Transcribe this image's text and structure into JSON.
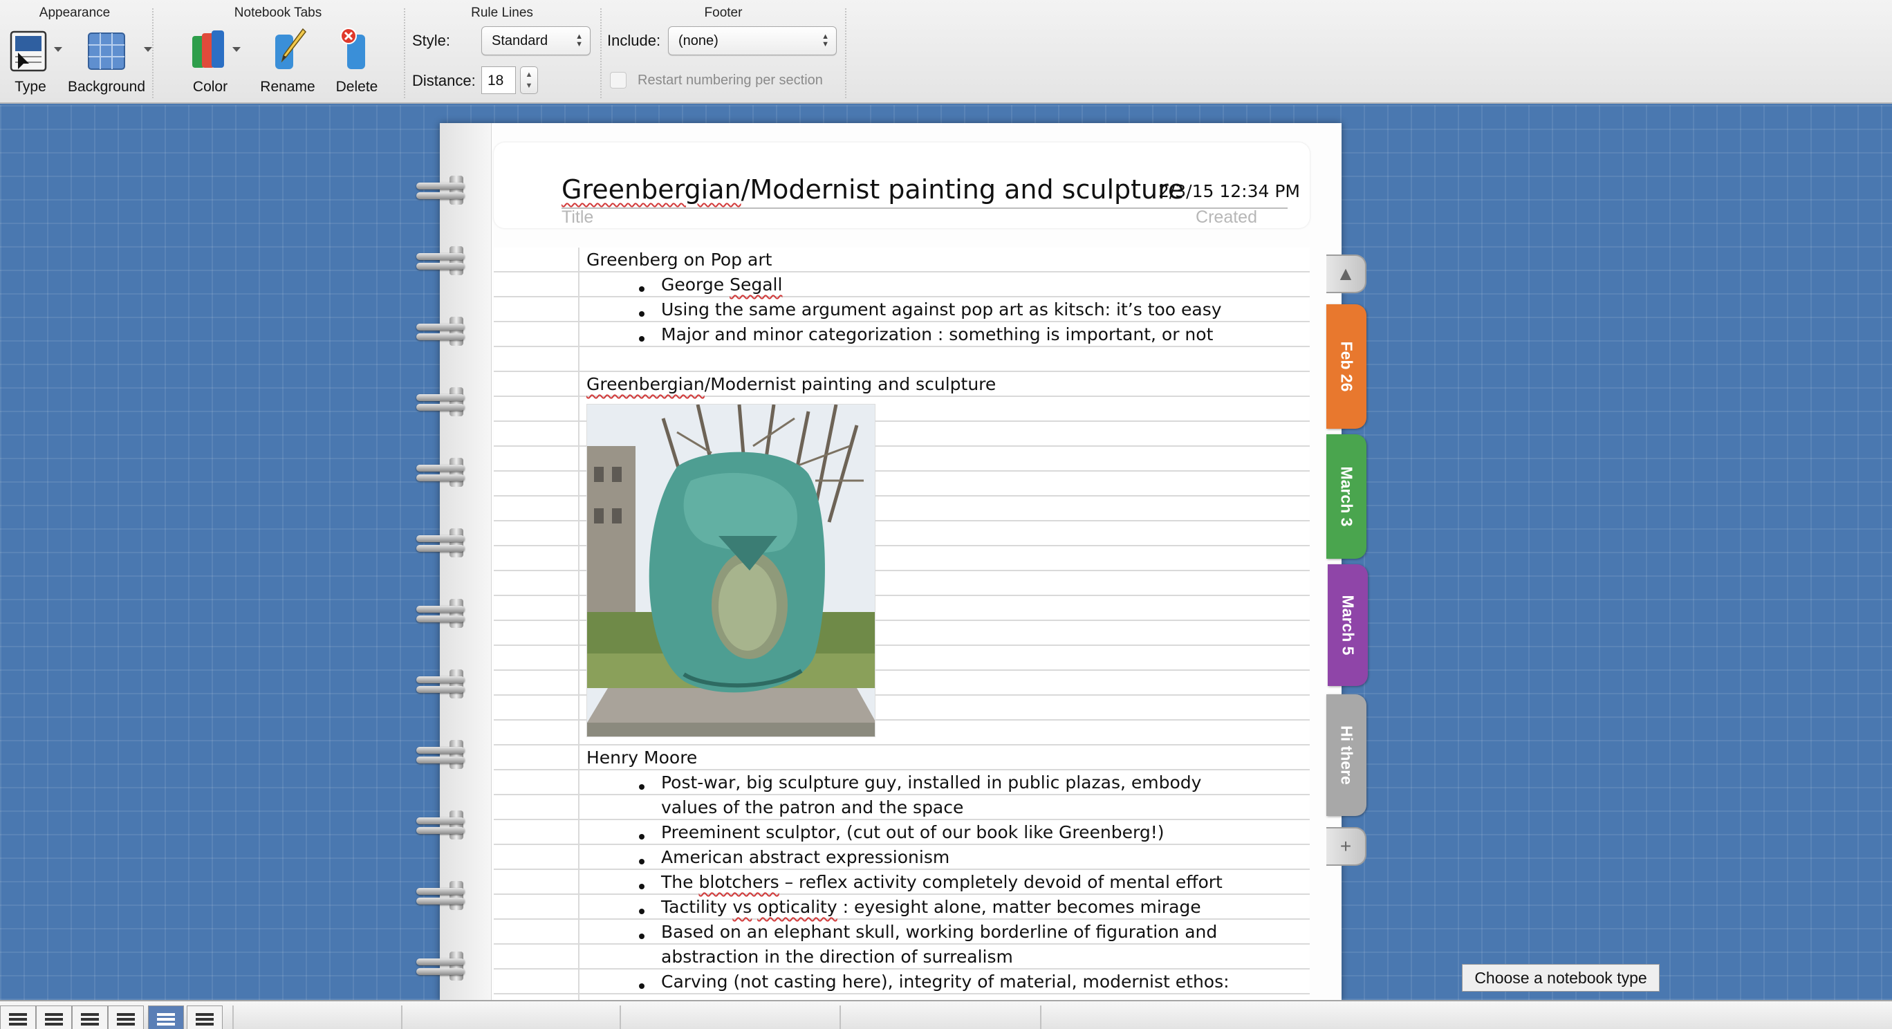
{
  "ribbon": {
    "appearance": {
      "title": "Appearance",
      "type_label": "Type",
      "background_label": "Background"
    },
    "notebook_tabs": {
      "title": "Notebook Tabs",
      "color_label": "Color",
      "rename_label": "Rename",
      "delete_label": "Delete"
    },
    "rule_lines": {
      "title": "Rule Lines",
      "style_label": "Style:",
      "style_value": "Standard",
      "distance_label": "Distance:",
      "distance_value": "18"
    },
    "footer": {
      "title": "Footer",
      "include_label": "Include:",
      "include_value": "(none)",
      "restart_label": "Restart numbering per section"
    }
  },
  "note": {
    "title_part1": "Greenbergian",
    "title_part2": "/Modernist painting and sculpture",
    "created": "2/3/15 12:34 PM",
    "title_hint": "Title",
    "created_hint": "Created",
    "lines": {
      "h1": "Greenberg on Pop art",
      "b1a": "George ",
      "b1b": "Segall",
      "b2": "Using the same argument against pop art as kitsch: it’s too easy",
      "b3": "Major and minor categorization : something is important, or not",
      "h2a": "Greenbergian",
      "h2b": "/Modernist painting and sculpture",
      "h3": "Henry Moore",
      "c1": "Post-war, big sculpture guy, installed in public plazas, embody",
      "c1b": "values of the patron and the space",
      "c2": "Preeminent sculptor, (cut out of our book like Greenberg!)",
      "c3": "American abstract expressionism",
      "c4a": "The ",
      "c4b": "blotchers",
      "c4c": " – reflex activity completely devoid of mental effort",
      "c5a": "Tactility ",
      "c5b": "vs",
      "c5c": " ",
      "c5d": "opticality",
      "c5e": " : eyesight alone, matter becomes mirage",
      "c6": "Based on an elephant skull, working borderline of figuration and",
      "c6b": "abstraction in the direction of surrealism",
      "c7": "Carving (not casting here), integrity of material, modernist ethos:"
    }
  },
  "tabs": [
    {
      "label": "Feb 26",
      "color": "#e8782e"
    },
    {
      "label": "March 3",
      "color": "#4aa54e"
    },
    {
      "label": "March 5",
      "color": "#8f45a8"
    },
    {
      "label": "Hi there",
      "color": "#a8a8a8"
    }
  ],
  "tab_controls": {
    "up": "▲",
    "add": "+"
  },
  "choose_button": "Choose a notebook type",
  "colors": {
    "desk": "#4a78b0",
    "accent_active_view": "#5a7fb6"
  }
}
